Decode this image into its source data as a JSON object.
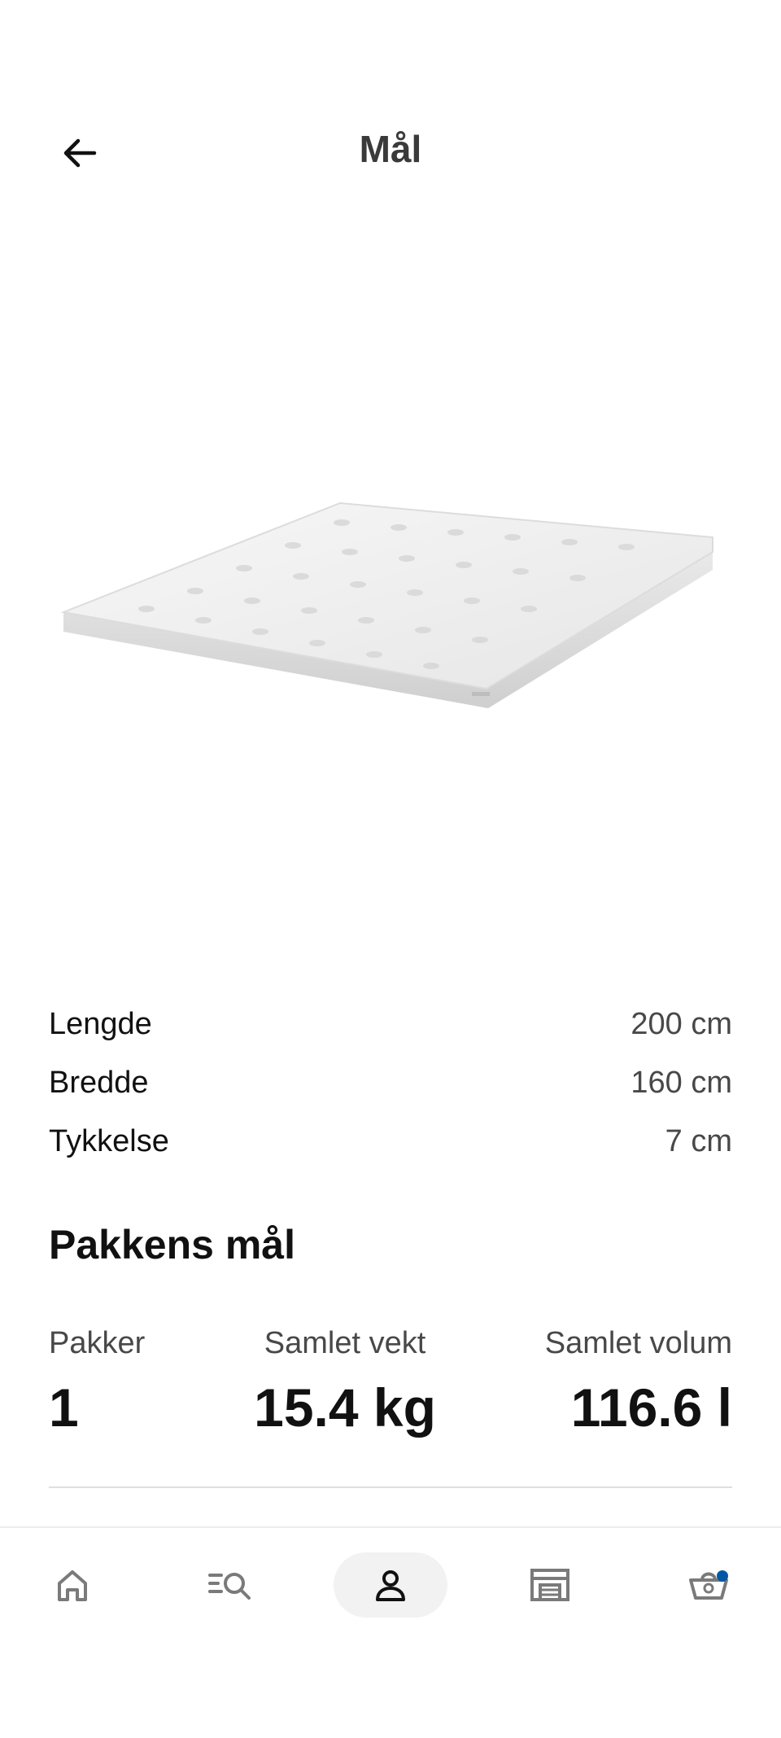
{
  "header": {
    "title": "Mål",
    "back_icon": "arrow-left-icon"
  },
  "dimensions": [
    {
      "label": "Lengde",
      "value": "200 cm"
    },
    {
      "label": "Bredde",
      "value": "160 cm"
    },
    {
      "label": "Tykkelse",
      "value": "7 cm"
    }
  ],
  "package": {
    "title": "Pakkens mål",
    "items": [
      {
        "label": "Pakker",
        "value": "1"
      },
      {
        "label": "Samlet vekt",
        "value": "15.4 kg"
      },
      {
        "label": "Samlet volum",
        "value": "116.6 l"
      }
    ]
  },
  "bottom_nav": {
    "items": [
      {
        "icon": "home-icon",
        "active": false
      },
      {
        "icon": "search-icon",
        "active": false
      },
      {
        "icon": "profile-icon",
        "active": true
      },
      {
        "icon": "store-icon",
        "active": false
      },
      {
        "icon": "cart-icon",
        "active": false,
        "badge": true
      }
    ]
  },
  "colors": {
    "accent": "#0058a3",
    "active_nav_bg": "#f2f2f2"
  }
}
